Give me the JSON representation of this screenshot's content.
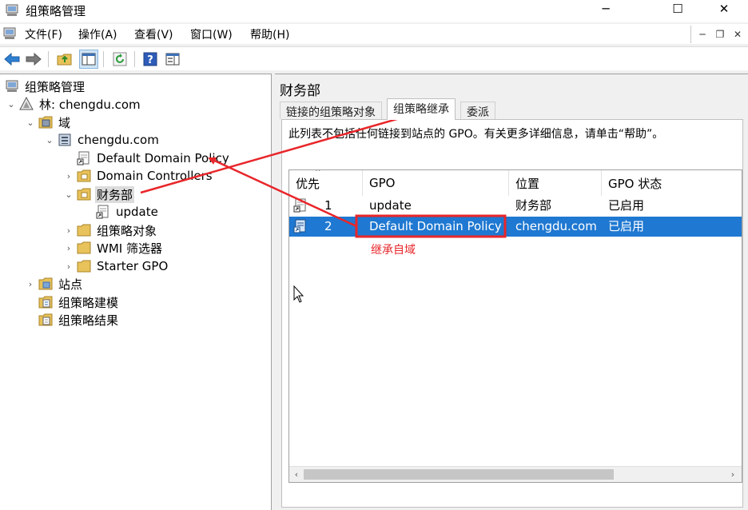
{
  "window": {
    "title": "组策略管理",
    "controls": {
      "minimize": "─",
      "maximize": "☐",
      "close": "✕"
    }
  },
  "menu": {
    "items": [
      "文件(F)",
      "操作(A)",
      "查看(V)",
      "窗口(W)",
      "帮助(H)"
    ],
    "mdi_controls": {
      "minimize": "─",
      "restore": "❐",
      "close": "✕"
    }
  },
  "toolbar": {
    "buttons": [
      "back-icon",
      "forward-icon",
      "up-folder-icon",
      "show-hide-tree-icon",
      "refresh-icon",
      "help-icon",
      "properties-icon"
    ]
  },
  "tree": {
    "root": "组策略管理",
    "forest": "林: chengdu.com",
    "domains": "域",
    "domain": "chengdu.com",
    "default_policy": "Default Domain Policy",
    "domain_controllers": "Domain Controllers",
    "ou_finance": "财务部",
    "ou_update": "update",
    "gpo_objects": "组策略对象",
    "wmi_filters": "WMI 筛选器",
    "starter_gpo": "Starter GPO",
    "sites": "站点",
    "modeling": "组策略建模",
    "results": "组策略结果"
  },
  "detail": {
    "title": "财务部",
    "tabs": [
      "链接的组策略对象",
      "组策略继承",
      "委派"
    ],
    "active_tab": 1,
    "info_text": "此列表不包括任何链接到站点的 GPO。有关更多详细信息，请单击“帮助”。",
    "columns": [
      "优先",
      "GPO",
      "位置",
      "GPO 状态"
    ],
    "rows": [
      {
        "precedence": "1",
        "gpo": "update",
        "location": "财务部",
        "status": "已启用"
      },
      {
        "precedence": "2",
        "gpo": "Default Domain Policy",
        "location": "chengdu.com",
        "status": "已启用"
      }
    ],
    "selected_row": 1,
    "scroll": {
      "left": "‹",
      "right": "›"
    }
  },
  "annotation": {
    "note": "继承自域",
    "color": "#e8262a"
  },
  "colors": {
    "selection": "#1f78d1",
    "tree_selection": "#dcdcdc"
  }
}
